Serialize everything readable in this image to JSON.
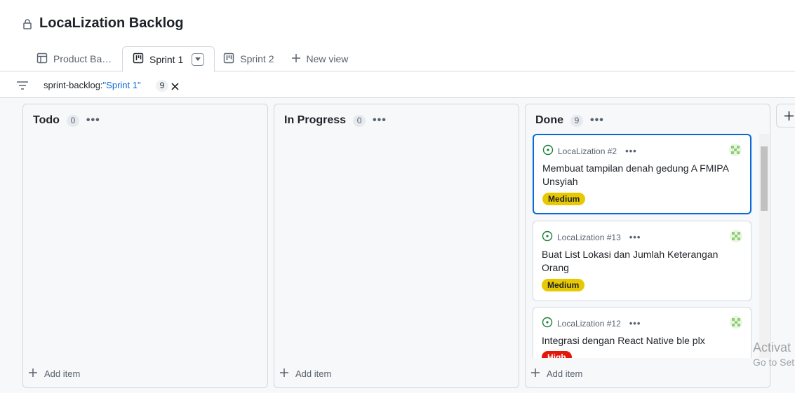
{
  "project": {
    "title": "LocaLization Backlog"
  },
  "tabs": [
    {
      "label": "Product Bac...",
      "icon": "table-icon"
    },
    {
      "label": "Sprint 1",
      "icon": "board-icon",
      "active": true
    },
    {
      "label": "Sprint 2",
      "icon": "board-icon"
    },
    {
      "label": "New view",
      "icon": "plus-icon"
    }
  ],
  "filter": {
    "key": "sprint-backlog:",
    "value": "\"Sprint 1\"",
    "count": "9"
  },
  "columns": [
    {
      "name": "Todo",
      "count": "0",
      "add_label": "Add item"
    },
    {
      "name": "In Progress",
      "count": "0",
      "add_label": "Add item"
    },
    {
      "name": "Done",
      "count": "9",
      "add_label": "Add item"
    }
  ],
  "cards": [
    {
      "ref": "LocaLization #2",
      "title": "Membuat tampilan denah gedung A FMIPA Unsyiah",
      "label": "Medium",
      "label_color": "#e8c900"
    },
    {
      "ref": "LocaLization #13",
      "title": "Buat List Lokasi dan Jumlah Keterangan Orang",
      "label": "Medium",
      "label_color": "#e8c900"
    },
    {
      "ref": "LocaLization #12",
      "title": "Integrasi dengan React Native ble plx",
      "label": "High",
      "label_color": "#e3170a"
    }
  ],
  "watermark": {
    "line1": "Activat",
    "line2": "Go to Set"
  },
  "colors": {
    "accent": "#0969da",
    "open_issue": "#1a7f37"
  }
}
